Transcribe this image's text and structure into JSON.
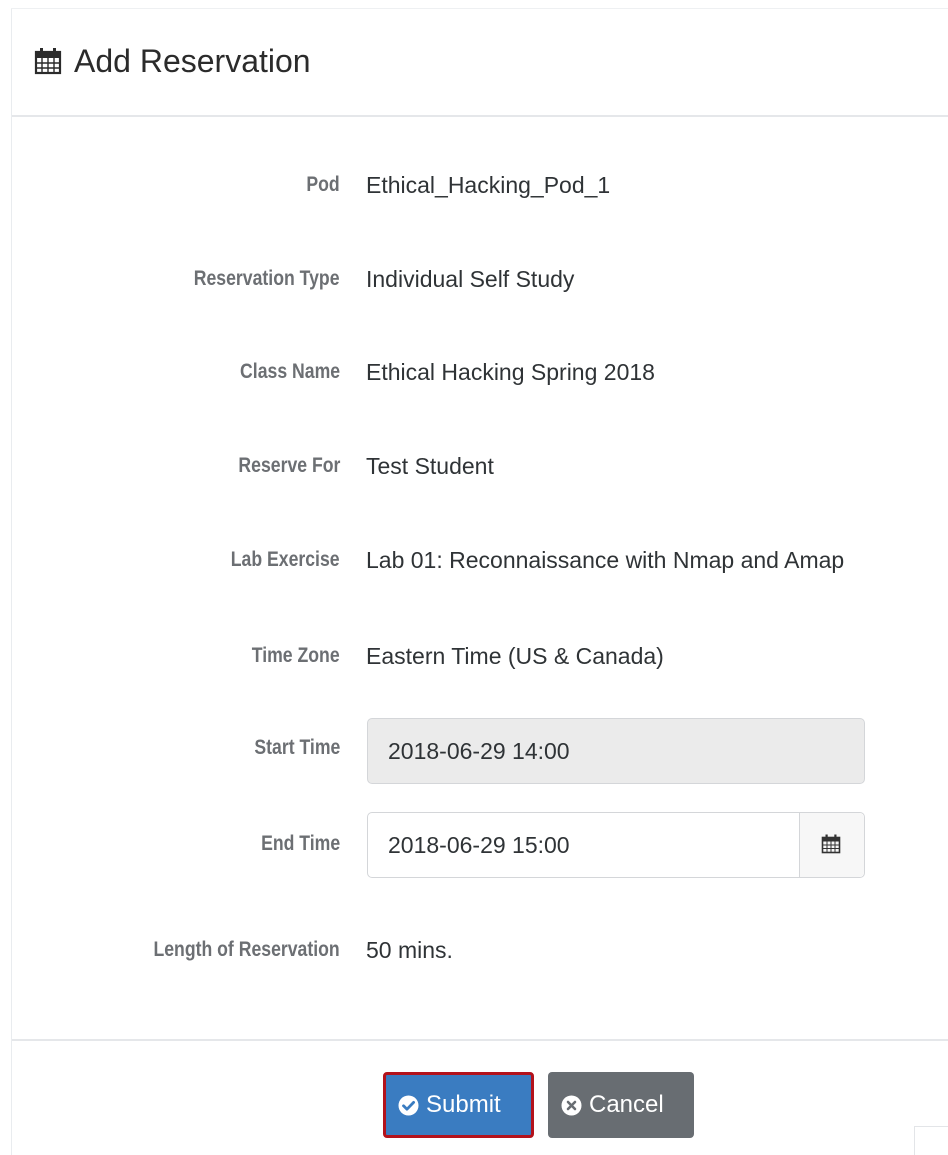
{
  "header": {
    "icon": "calendar-icon",
    "title": "Add Reservation"
  },
  "details": [
    {
      "label": "Pod",
      "value": "Ethical_Hacking_Pod_1"
    },
    {
      "label": "Reservation Type",
      "value": "Individual Self Study"
    },
    {
      "label": "Class Name",
      "value": "Ethical Hacking Spring 2018"
    },
    {
      "label": "Reserve For",
      "value": "Test Student"
    },
    {
      "label": "Lab Exercise",
      "value": "Lab 01: Reconnaissance with Nmap and Amap"
    },
    {
      "label": "Time Zone",
      "value": "Eastern Time (US & Canada)"
    }
  ],
  "start_time": {
    "label": "Start Time",
    "value": "2018-06-29 14:00",
    "disabled": true
  },
  "end_time": {
    "label": "End Time",
    "value": "2018-06-29 15:00",
    "addon_icon": "calendar-icon"
  },
  "length": {
    "label": "Length of Reservation",
    "value": "50 mins."
  },
  "buttons": {
    "submit": {
      "label": "Submit",
      "icon": "check-circle-icon",
      "color": "#3a7cc1",
      "outline": "#b3121b"
    },
    "cancel": {
      "label": "Cancel",
      "icon": "times-circle-icon",
      "color": "#686d72"
    }
  }
}
